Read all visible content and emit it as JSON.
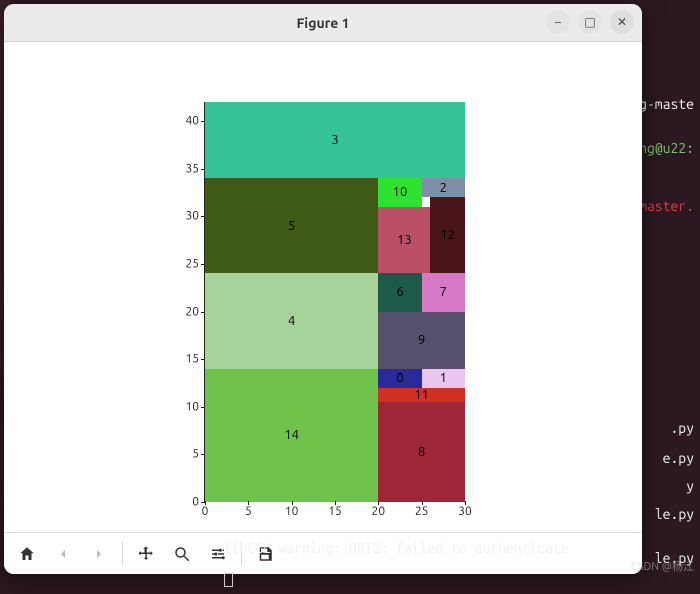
{
  "window": {
    "title": "Figure 1"
  },
  "controls": {
    "minimize": "–",
    "maximize": "□",
    "close": "×"
  },
  "toolbar": {
    "home": "Home",
    "back": "Back",
    "forward": "Forward",
    "pan": "Pan",
    "zoom": "Zoom",
    "configure": "Configure",
    "save": "Save"
  },
  "background": {
    "items": [
      "ng-maste",
      "ng@u22:",
      "-master.",
      ".py",
      "e.py",
      "y",
      "le.py",
      "le.py"
    ],
    "terminal_line": "libEGL warning: DRI2: failed to authenticate"
  },
  "watermark": "CSDN @杨江",
  "chart_data": {
    "type": "rect",
    "title": "",
    "xlabel": "",
    "ylabel": "",
    "xlim": [
      0,
      30
    ],
    "ylim": [
      0,
      42
    ],
    "xticks": [
      0,
      5,
      10,
      15,
      20,
      25,
      30
    ],
    "yticks": [
      0,
      5,
      10,
      15,
      20,
      25,
      30,
      35,
      40
    ],
    "rects": [
      {
        "label": "3",
        "x0": 0,
        "x1": 30,
        "y0": 34,
        "y1": 42,
        "fill": "#34c497"
      },
      {
        "label": "5",
        "x0": 0,
        "x1": 20,
        "y0": 24,
        "y1": 34,
        "fill": "#3f5a14"
      },
      {
        "label": "4",
        "x0": 0,
        "x1": 20,
        "y0": 14,
        "y1": 24,
        "fill": "#a6d39a"
      },
      {
        "label": "14",
        "x0": 0,
        "x1": 20,
        "y0": 0,
        "y1": 14,
        "fill": "#6fc24a"
      },
      {
        "label": "10",
        "x0": 20,
        "x1": 25,
        "y0": 31,
        "y1": 34,
        "fill": "#2fe22f"
      },
      {
        "label": "2",
        "x0": 25,
        "x1": 30,
        "y0": 32,
        "y1": 34,
        "fill": "#7d8fa8"
      },
      {
        "label": "13",
        "x0": 20,
        "x1": 26,
        "y0": 24,
        "y1": 31,
        "fill": "#b95067"
      },
      {
        "label": "12",
        "x0": 26,
        "x1": 30,
        "y0": 24,
        "y1": 32,
        "fill": "#4a1518"
      },
      {
        "label": "6",
        "x0": 20,
        "x1": 25,
        "y0": 20,
        "y1": 24,
        "fill": "#1e5a49"
      },
      {
        "label": "7",
        "x0": 25,
        "x1": 30,
        "y0": 20,
        "y1": 24,
        "fill": "#d678c5"
      },
      {
        "label": "9",
        "x0": 20,
        "x1": 30,
        "y0": 14,
        "y1": 20,
        "fill": "#56506d"
      },
      {
        "label": "0",
        "x0": 20,
        "x1": 25,
        "y0": 12,
        "y1": 14,
        "fill": "#2a2a99"
      },
      {
        "label": "1",
        "x0": 25,
        "x1": 30,
        "y0": 12,
        "y1": 14,
        "fill": "#e9c5ef"
      },
      {
        "label": "11",
        "x0": 20,
        "x1": 30,
        "y0": 10.5,
        "y1": 12,
        "fill": "#d13024"
      },
      {
        "label": "8",
        "x0": 20,
        "x1": 30,
        "y0": 0,
        "y1": 10.5,
        "fill": "#9d2738"
      }
    ]
  }
}
